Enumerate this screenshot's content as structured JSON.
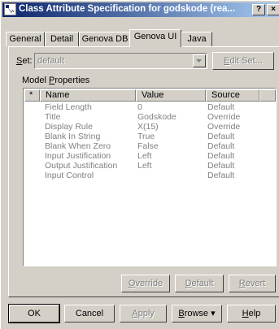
{
  "window": {
    "title": "Class Attribute Specification for godskode (rea...",
    "help_btn": "?",
    "close_btn": "×"
  },
  "tabs": [
    {
      "label": "General"
    },
    {
      "label": "Detail"
    },
    {
      "label": "Genova DB"
    },
    {
      "label": "Genova UI",
      "active": true
    },
    {
      "label": "Java"
    }
  ],
  "set_row": {
    "label_prefix": "S",
    "label_rest": "et:",
    "value": "default",
    "edit_btn_u": "E",
    "edit_btn_rest": "dit Set..."
  },
  "model_props": {
    "label_pre": "Model ",
    "label_u": "P",
    "label_rest": "roperties"
  },
  "grid": {
    "headers": {
      "star": "*",
      "name": "Name",
      "value": "Value",
      "source": "Source"
    },
    "rows": [
      {
        "name": "Field Length",
        "value": "0",
        "source": "Default"
      },
      {
        "name": "Title",
        "value": "Godskode",
        "source": "Override"
      },
      {
        "name": "Display Rule",
        "value": "X(15)",
        "source": "Override"
      },
      {
        "name": "Blank In String",
        "value": "True",
        "source": "Default"
      },
      {
        "name": "Blank When Zero",
        "value": "False",
        "source": "Default"
      },
      {
        "name": "Input Justification",
        "value": "Left",
        "source": "Default"
      },
      {
        "name": "Output Justification",
        "value": "Left",
        "source": "Default"
      },
      {
        "name": "Input Control",
        "value": "",
        "source": "Default"
      }
    ]
  },
  "grid_buttons": {
    "override_u": "O",
    "override_rest": "verride",
    "default_u": "D",
    "default_rest": "efault",
    "revert_u": "R",
    "revert_rest": "evert"
  },
  "footer": {
    "ok": "OK",
    "cancel": "Cancel",
    "apply_u": "A",
    "apply_rest": "pply",
    "browse_u": "B",
    "browse_rest": "rowse ▾",
    "help_u": "H",
    "help_rest": "elp"
  },
  "colors": {
    "titlebar_start": "#0a246a",
    "titlebar_end": "#a6caf0",
    "face": "#d4d0c8"
  }
}
